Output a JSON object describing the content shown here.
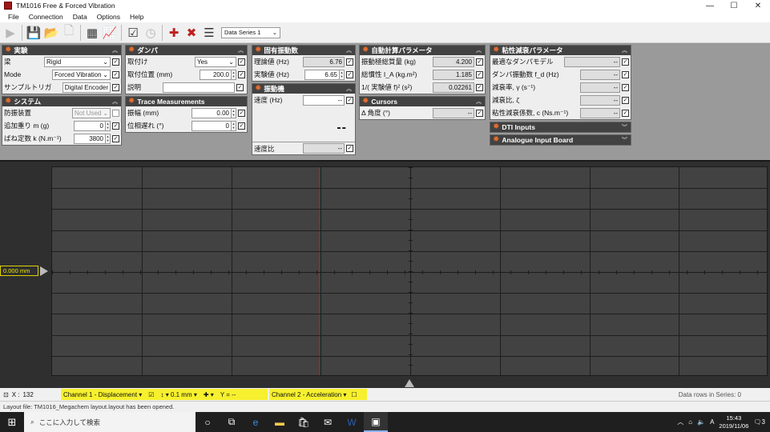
{
  "window": {
    "title": "TM1016 Free & Forced Vibration",
    "minimize": "—",
    "maximize": "☐",
    "close": "✕"
  },
  "menu": [
    "File",
    "Connection",
    "Data",
    "Options",
    "Help"
  ],
  "toolbar": {
    "series_select": "Data Series 1"
  },
  "panels": {
    "experiment": {
      "title": "実験",
      "rows": [
        {
          "label": "梁",
          "value": "Rigid"
        },
        {
          "label": "Mode",
          "value": "Forced Vibration"
        },
        {
          "label": "サンプルトリガ",
          "value": "Digital Encoder"
        }
      ]
    },
    "system": {
      "title": "システム",
      "rows": [
        {
          "label": "防振装置",
          "value": "Not Used"
        },
        {
          "label": "追加重り m  (g)",
          "value": "0"
        },
        {
          "label": "ばね定数 k  (N.m⁻¹)",
          "value": "3800"
        }
      ]
    },
    "damper": {
      "title": "ダンパ",
      "rows": [
        {
          "label": "取付け",
          "value": "Yes"
        },
        {
          "label": "取付位置  (mm)",
          "value": "200.0"
        },
        {
          "label": "説明",
          "value": ""
        }
      ]
    },
    "trace": {
      "title": "Trace Measurements",
      "rows": [
        {
          "label": "振幅  (mm)",
          "value": "0.00"
        },
        {
          "label": "位相遅れ  (°)",
          "value": "0"
        }
      ]
    },
    "natural_freq": {
      "title": "固有振動数",
      "rows": [
        {
          "label": "理論値  (Hz)",
          "value": "6.76"
        },
        {
          "label": "実験値  (Hz)",
          "value": "6.65"
        }
      ]
    },
    "exciter": {
      "title": "振動機",
      "rows": [
        {
          "label": "速度  (Hz)",
          "value": "--"
        },
        {
          "label": "速度比",
          "value": "--"
        }
      ],
      "big_value": "--"
    },
    "auto_calc": {
      "title": "自動計算パラメータ",
      "rows": [
        {
          "label": "振動極総質量  (kg)",
          "value": "4.200"
        },
        {
          "label": "総慣性 I_A  (kg.m²)",
          "value": "1.185"
        },
        {
          "label": "1/( 実験値 f)²  (s²)",
          "value": "0.02261"
        }
      ]
    },
    "cursors": {
      "title": "Cursors",
      "rows": [
        {
          "label": "Δ 角度  (°)",
          "value": "--"
        }
      ]
    },
    "viscous": {
      "title": "粘性減衰パラメータ",
      "rows": [
        {
          "label": "最適なダンパモデル",
          "value": "--"
        },
        {
          "label": "ダンパ振動数 f_d  (Hz)",
          "value": "--"
        },
        {
          "label": "減衰率, γ  (s⁻¹)",
          "value": "--"
        },
        {
          "label": "減衰比, ζ",
          "value": "--"
        },
        {
          "label": "粘性減衰係数, c  (Ns.m⁻¹)",
          "value": "--"
        }
      ]
    },
    "dti": {
      "title": "DTI Inputs"
    },
    "analogue": {
      "title": "Analogue Input Board"
    }
  },
  "plot": {
    "y_readout": "0.000 mm"
  },
  "channel_bar": {
    "x_readout_label": "X :",
    "x_readout_value": "132",
    "channel1": "Channel 1 - Displacement",
    "scale": "0.1 mm",
    "y_value": "Y = --",
    "channel2": "Channel 2 - Acceleration",
    "data_rows": "Data rows in Series: 0"
  },
  "status": {
    "text": "Layout file: TM1016_Megachem layout.layout has been opened."
  },
  "taskbar": {
    "search_placeholder": "ここに入力して検索",
    "time": "15:43",
    "date": "2019/11/06",
    "ime": "A",
    "notif_count": "3"
  },
  "colors": {
    "panel_header": "#424242",
    "gear": "#e26b2e",
    "plot_bg": "#424242",
    "cursor": "#b02020",
    "channel_highlight": "#f6f02e"
  }
}
